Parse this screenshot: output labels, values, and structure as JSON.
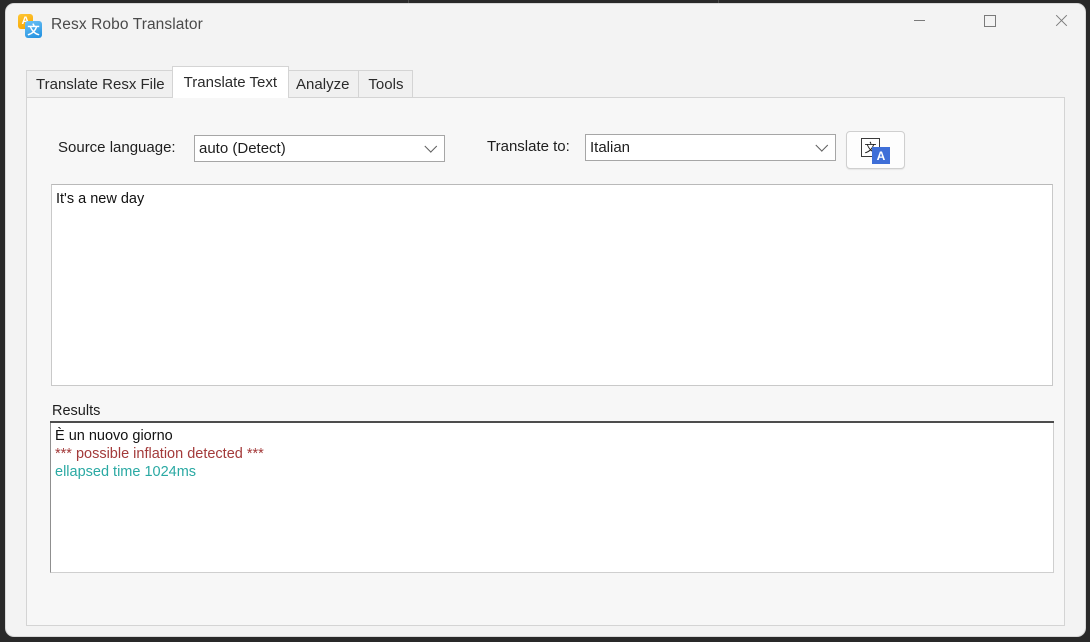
{
  "window": {
    "title": "Resx Robo Translator",
    "icon": "translate-app-icon",
    "icon_orange_glyph": "A",
    "icon_blue_glyph": "文",
    "controls": {
      "minimize": "minimize-icon",
      "maximize": "maximize-icon",
      "close": "close-icon"
    }
  },
  "tabs": [
    {
      "label": "Translate Resx File",
      "active": false
    },
    {
      "label": "Translate Text",
      "active": true
    },
    {
      "label": "Analyze",
      "active": false
    },
    {
      "label": "Tools",
      "active": false
    }
  ],
  "form": {
    "source_language_label": "Source language:",
    "source_language_value": "auto (Detect)",
    "target_language_label": "Translate to:",
    "target_language_value": "Italian",
    "translate_button": {
      "name": "translate-button",
      "cjk_glyph": "文",
      "latin_glyph": "A"
    }
  },
  "source_text": {
    "value": "It's a new day",
    "placeholder": ""
  },
  "results": {
    "group_label": "Results",
    "lines": [
      {
        "text": "È un nuovo giorno",
        "color": "#111111"
      },
      {
        "text": "*** possible inflation detected ***",
        "color": "#a33a3a"
      },
      {
        "text": "ellapsed time 1024ms",
        "color": "#2aa9a3"
      }
    ]
  },
  "colors": {
    "window_bg": "#f3f3f3",
    "panel_bg": "#f7f7f7",
    "field_bg": "#ffffff",
    "text": "#1e1e1e",
    "title_text": "#4a4a4a",
    "warning": "#a33a3a",
    "timing": "#2aa9a3",
    "accent_blue": "#3f6fd8",
    "accent_orange": "#f5a200"
  }
}
